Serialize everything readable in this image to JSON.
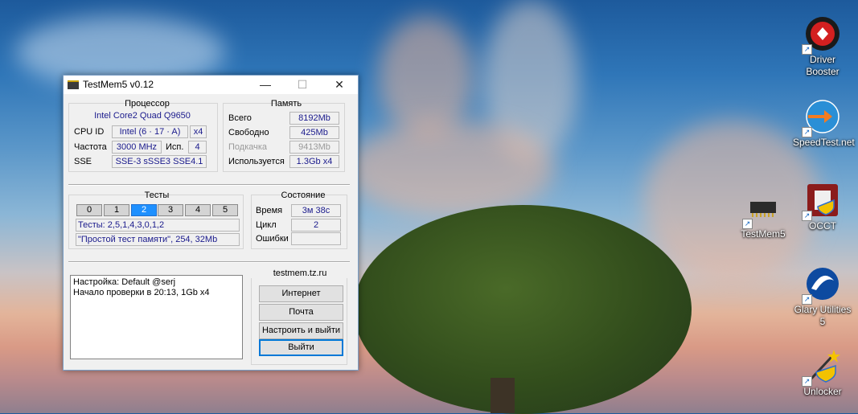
{
  "desktop": {
    "icons": [
      {
        "label_1": "Driver",
        "label_2": "Booster"
      },
      {
        "label_1": "SpeedTest.net",
        "label_2": ""
      },
      {
        "label_1": "TestMem5",
        "label_2": ""
      },
      {
        "label_1": "OCCT",
        "label_2": ""
      },
      {
        "label_1": "Glary Utilities",
        "label_2": "5"
      },
      {
        "label_1": "Unlocker",
        "label_2": ""
      }
    ]
  },
  "window": {
    "title": "TestMem5 v0.12",
    "minimize_glyph": "—",
    "maximize_glyph": "☐",
    "close_glyph": "✕",
    "cpu": {
      "title": "Процессор",
      "name": "Intel Core2 Quad  Q9650",
      "cpuid_label": "CPU ID",
      "cpuid_value": "Intel  (6 · 17 · A)",
      "cpuid_threads": "x4",
      "freq_label": "Частота",
      "freq_value": "3000 MHz",
      "used_label": "Исп.",
      "used_value": "4",
      "sse_label": "SSE",
      "sse_value": "SSE-3 sSSE3 SSE4.1"
    },
    "memory": {
      "title": "Память",
      "total_label": "Всего",
      "total_value": "8192Mb",
      "free_label": "Свободно",
      "free_value": "425Mb",
      "swap_label": "Подкачка",
      "swap_value": "9413Mb",
      "used_label": "Используется",
      "used_value": "1.3Gb x4"
    },
    "tests": {
      "title": "Тесты",
      "tabs": [
        "0",
        "1",
        "2",
        "3",
        "4",
        "5"
      ],
      "active_tab": "2",
      "sequence": "Тесты: 2,5,1,4,3,0,1,2",
      "current": "\"Простой тест памяти\", 254, 32Mb"
    },
    "state": {
      "title": "Состояние",
      "time_label": "Время",
      "time_value": "3м 38с",
      "cycle_label": "Цикл",
      "cycle_value": "2",
      "errors_label": "Ошибки",
      "errors_value": ""
    },
    "log": [
      "Настройка: Default @serj",
      "Начало проверки в 20:13, 1Gb x4"
    ],
    "site": {
      "title": "testmem.tz.ru",
      "internet": "Интернет",
      "mail": "Почта",
      "configure_exit": "Настроить и выйти",
      "exit": "Выйти"
    }
  }
}
